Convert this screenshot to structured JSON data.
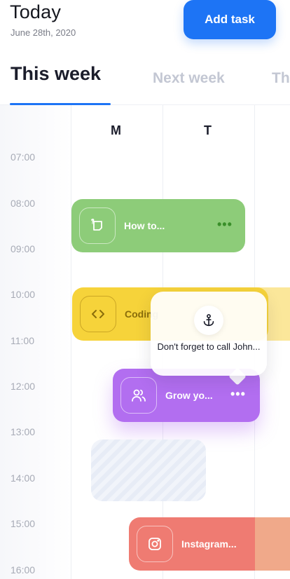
{
  "header": {
    "title": "Today",
    "date": "June 28th, 2020",
    "add_task_label": "Add task"
  },
  "tabs": [
    {
      "label": "This week",
      "active": true
    },
    {
      "label": "Next week",
      "active": false
    },
    {
      "label": "Th",
      "active": false
    }
  ],
  "days": [
    "M",
    "T"
  ],
  "times": [
    "07:00",
    "08:00",
    "09:00",
    "10:00",
    "11:00",
    "12:00",
    "13:00",
    "14:00",
    "15:00",
    "16:00"
  ],
  "events": {
    "howto": {
      "title": "How to...",
      "icon": "task-icon",
      "color": "#8dcc79",
      "dots": "•••"
    },
    "coding": {
      "title": "Coding",
      "icon": "code-icon",
      "color": "#f6d33a"
    },
    "grow": {
      "title": "Grow yo...",
      "icon": "users-icon",
      "color": "#b26ef0",
      "dots": "•••"
    },
    "instagram": {
      "title": "Instagram...",
      "icon": "instagram-icon",
      "color": "#ef7b72"
    }
  },
  "tooltip": {
    "icon": "anchor-icon",
    "text": "Don't forget to call John..."
  },
  "colors": {
    "accent": "#1d74f5"
  }
}
